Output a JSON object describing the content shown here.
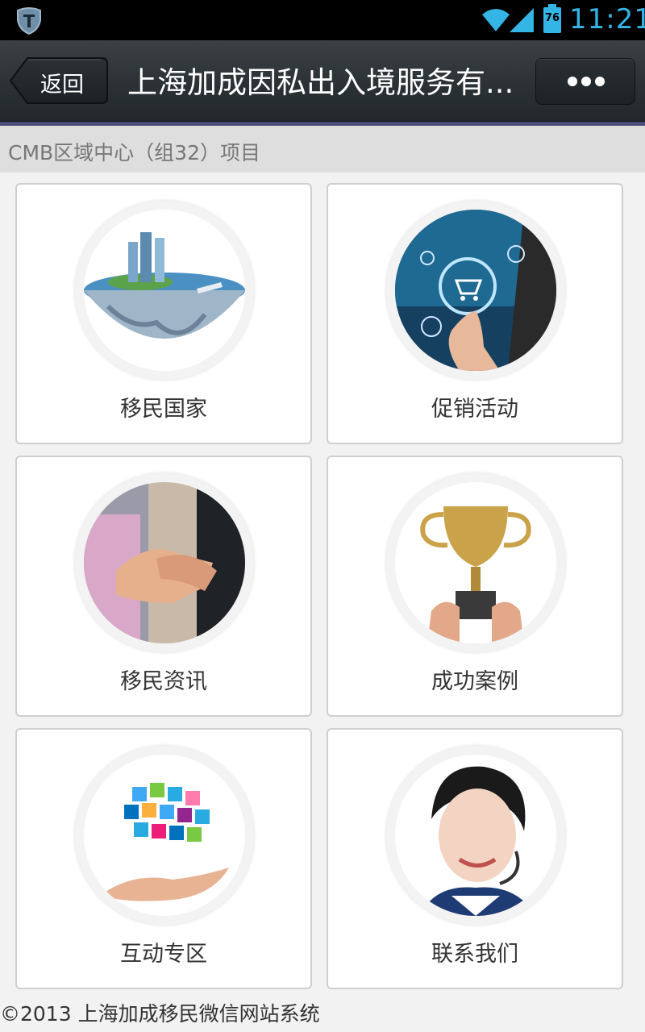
{
  "status_bar": {
    "battery": "76",
    "time": "11:21"
  },
  "header": {
    "back_label": "返回",
    "title": "上海加成因私出入境服务有...",
    "more_icon": "more-dots-icon"
  },
  "section": {
    "title": "CMB区域中心（组32）项目"
  },
  "tiles": [
    {
      "label": "移民国家",
      "image": "globe-city-image"
    },
    {
      "label": "促销活动",
      "image": "shopping-cart-touch-image"
    },
    {
      "label": "移民资讯",
      "image": "handshake-image"
    },
    {
      "label": "成功案例",
      "image": "trophy-image"
    },
    {
      "label": "互动专区",
      "image": "app-icons-hand-image"
    },
    {
      "label": "联系我们",
      "image": "customer-service-agent-image"
    }
  ],
  "footer": {
    "text": "©2013 上海加成移民微信网站系统"
  }
}
